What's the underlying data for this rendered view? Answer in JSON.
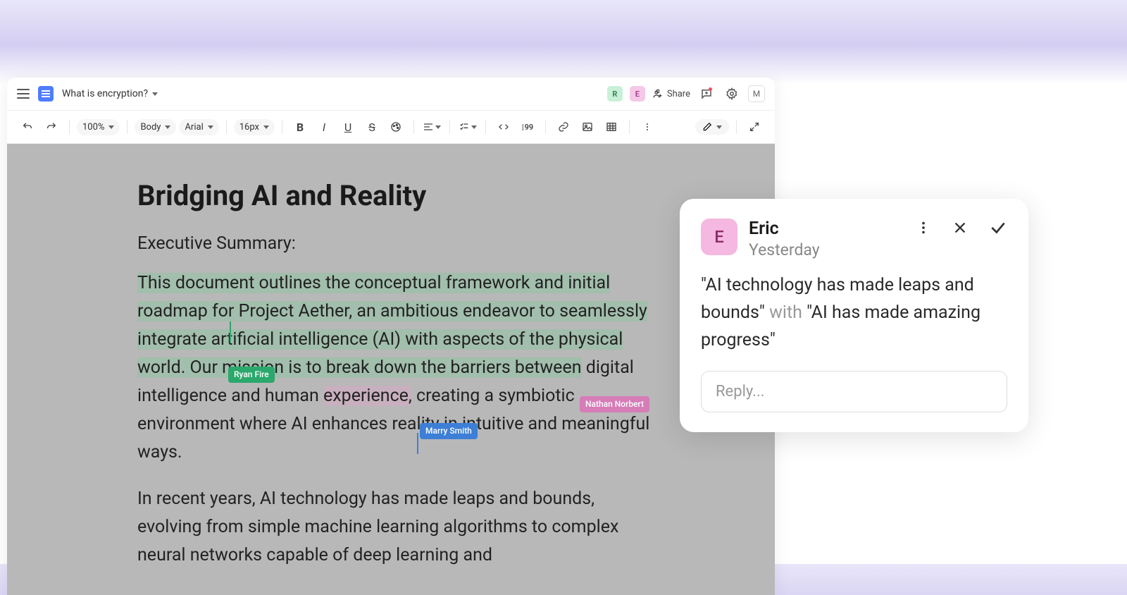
{
  "titlebar": {
    "doc_title": "What is encryption?",
    "avatars": {
      "r": "R",
      "e": "E"
    },
    "share_label": "Share",
    "m_label": "M"
  },
  "toolbar": {
    "zoom": "100%",
    "style": "Body",
    "font": "Arial",
    "size": "16px",
    "counter": "99"
  },
  "document": {
    "title": "Bridging AI and Reality",
    "subheading": "Executive Summary:",
    "p1_a": "This document outlines the conceptual framework and initial roadmap for Project Aether, an ambitious endeavor to seamlessly",
    "p1_b": " integrate artificial intelligence (AI) with aspects of the physical world. Our mission is to break down the barriers between",
    "p1_c": " digital intelligence and human ",
    "p1_d": "experience,",
    "p1_e": " creating a symbiotic environment where AI enhances reality in intuitive and meaningful ways.",
    "p2": "In recent years, AI technology has made leaps and bounds, evolving from simple machine learning algorithms to complex neural networks capable of deep learning and",
    "cursors": {
      "ryan": "Ryan Fire",
      "nathan": "Nathan Norbert",
      "marry": "Marry Smith"
    }
  },
  "comment": {
    "avatar_letter": "E",
    "author": "Eric",
    "time": "Yesterday",
    "quote_a": "\"AI technology has made leaps and bounds\"",
    "with": " with ",
    "quote_b": "\"AI has made amazing progress\"",
    "reply_placeholder": "Reply..."
  }
}
